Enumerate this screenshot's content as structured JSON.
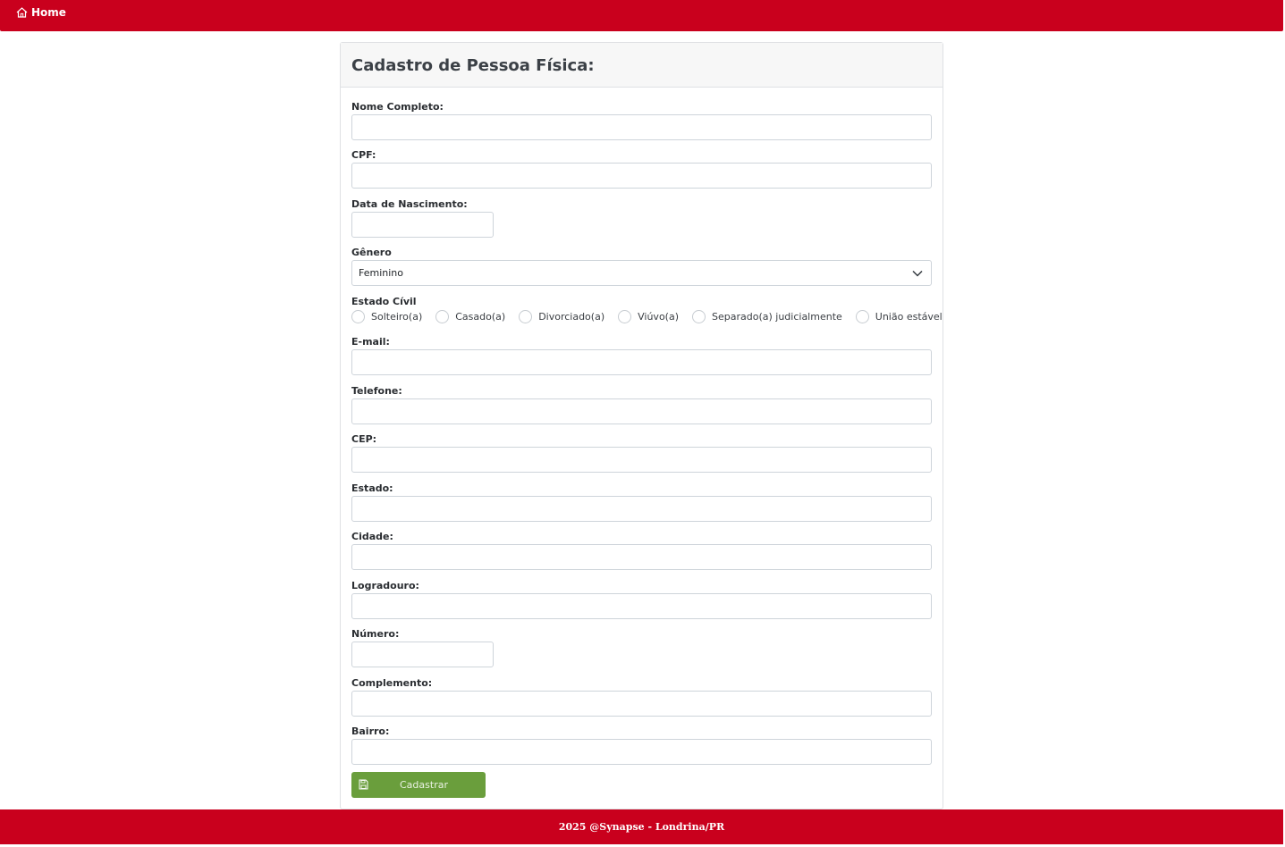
{
  "nav": {
    "home_label": "Home"
  },
  "form": {
    "title": "Cadastro de Pessoa Física:",
    "fields": {
      "nome": {
        "label": "Nome Completo:",
        "value": ""
      },
      "cpf": {
        "label": "CPF:",
        "value": ""
      },
      "nascimento": {
        "label": "Data de Nascimento:",
        "value": ""
      },
      "genero": {
        "label": "Gênero",
        "selected": "Feminino"
      },
      "estado_civil": {
        "label": "Estado Cívil",
        "options": [
          "Solteiro(a)",
          "Casado(a)",
          "Divorciado(a)",
          "Viúvo(a)",
          "Separado(a) judicialmente",
          "União estável"
        ]
      },
      "email": {
        "label": "E-mail:",
        "value": ""
      },
      "telefone": {
        "label": "Telefone:",
        "value": ""
      },
      "cep": {
        "label": "CEP:",
        "value": ""
      },
      "estado": {
        "label": "Estado:",
        "value": ""
      },
      "cidade": {
        "label": "Cidade:",
        "value": ""
      },
      "logradouro": {
        "label": "Logradouro:",
        "value": ""
      },
      "numero": {
        "label": "Número:",
        "value": ""
      },
      "complemento": {
        "label": "Complemento:",
        "value": ""
      },
      "bairro": {
        "label": "Bairro:",
        "value": ""
      }
    },
    "submit_label": "Cadastrar"
  },
  "footer": {
    "text": "2025 @Synapse - Londrina/PR"
  },
  "colors": {
    "brand_red": "#c9001d",
    "submit_green": "#6a9e3c"
  },
  "icons": {
    "nav": "home-icon",
    "select": "chevron-down-icon",
    "submit": "save-icon"
  }
}
